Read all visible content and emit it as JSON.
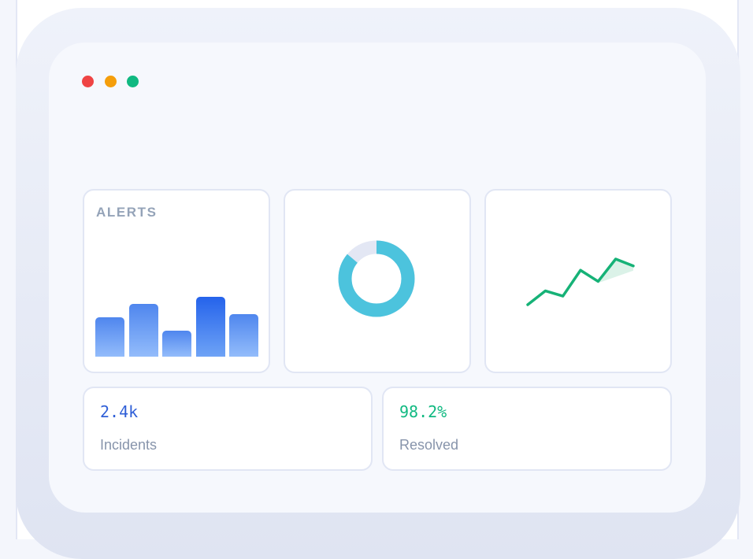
{
  "window": {
    "controls": {
      "close": {
        "color": "#ef4444"
      },
      "minimize": {
        "color": "#f59e0b"
      },
      "maximize": {
        "color": "#10b981"
      }
    }
  },
  "widgets": {
    "alerts": {
      "title": "ALERTS",
      "bars": [
        {
          "value": 50,
          "shade": "light"
        },
        {
          "value": 67,
          "shade": "light"
        },
        {
          "value": 33,
          "shade": "light"
        },
        {
          "value": 76,
          "shade": "dark"
        },
        {
          "value": 54,
          "shade": "light"
        }
      ]
    },
    "donut": {
      "value_fraction": 0.86,
      "color": "#4cc3dd",
      "track_color": "#e3e7f4"
    },
    "trend": {
      "points": [
        2,
        18,
        12,
        42,
        29,
        55,
        47
      ],
      "color": "#16b277"
    }
  },
  "stats": [
    {
      "value": "2.4k",
      "label": "Incidents",
      "color": "#2f5fd7"
    },
    {
      "value": "98.2%",
      "label": "Resolved",
      "color": "#10b981"
    }
  ]
}
